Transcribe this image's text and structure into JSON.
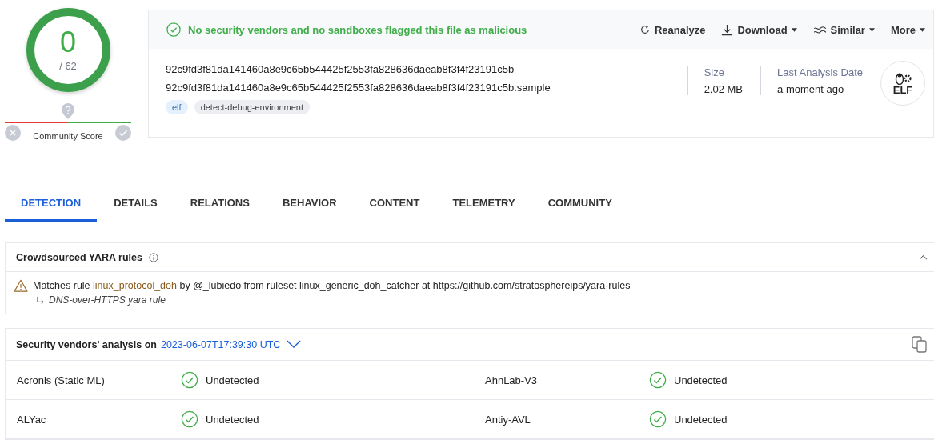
{
  "score": {
    "detections": "0",
    "total": "/ 62"
  },
  "community": {
    "label": "Community Score"
  },
  "banner": {
    "message": "No security vendors and no sandboxes flagged this file as malicious"
  },
  "actions": [
    {
      "label": "Reanalyze",
      "kind": "reanalyze",
      "caret": false
    },
    {
      "label": "Download",
      "kind": "download",
      "caret": true
    },
    {
      "label": "Similar",
      "kind": "similar",
      "caret": true
    },
    {
      "label": "More",
      "kind": "more",
      "caret": true
    }
  ],
  "file": {
    "hash": "92c9fd3f81da141460a8e9c65b544425f2553fa828636daeab8f3f4f23191c5b",
    "name": "92c9fd3f81da141460a8e9c65b544425f2553fa828636daeab8f3f4f23191c5b.sample",
    "tags": [
      {
        "label": "elf",
        "kind": "type"
      },
      {
        "label": "detect-debug-environment",
        "kind": "tag"
      }
    ]
  },
  "meta": [
    {
      "label": "Size",
      "value": "2.02 MB"
    },
    {
      "label": "Last Analysis Date",
      "value": "a moment ago"
    }
  ],
  "filetype": {
    "label": "ELF"
  },
  "tabs": [
    {
      "label": "DETECTION",
      "selected": true
    },
    {
      "label": "DETAILS",
      "selected": false
    },
    {
      "label": "RELATIONS",
      "selected": false
    },
    {
      "label": "BEHAVIOR",
      "selected": false
    },
    {
      "label": "CONTENT",
      "selected": false
    },
    {
      "label": "TELEMETRY",
      "selected": false
    },
    {
      "label": "COMMUNITY",
      "selected": false
    }
  ],
  "yara": {
    "title": "Crowdsourced YARA rules",
    "expanded": true,
    "matches": [
      {
        "prefix": "Matches rule",
        "rule": "linux_protocol_doh",
        "rest": "by @_lubiedo from ruleset linux_generic_doh_catcher at https://github.com/stratosphereips/yara-rules",
        "description": "DNS-over-HTTPS yara rule"
      }
    ]
  },
  "vendors": {
    "title": "Security vendors' analysis on",
    "date": "2023-06-07T17:39:30 UTC",
    "rows": [
      [
        {
          "vendor": "Acronis (Static ML)",
          "result": "Undetected"
        },
        {
          "vendor": "AhnLab-V3",
          "result": "Undetected"
        }
      ],
      [
        {
          "vendor": "ALYac",
          "result": "Undetected"
        },
        {
          "vendor": "Antiy-AVL",
          "result": "Undetected"
        }
      ]
    ]
  }
}
